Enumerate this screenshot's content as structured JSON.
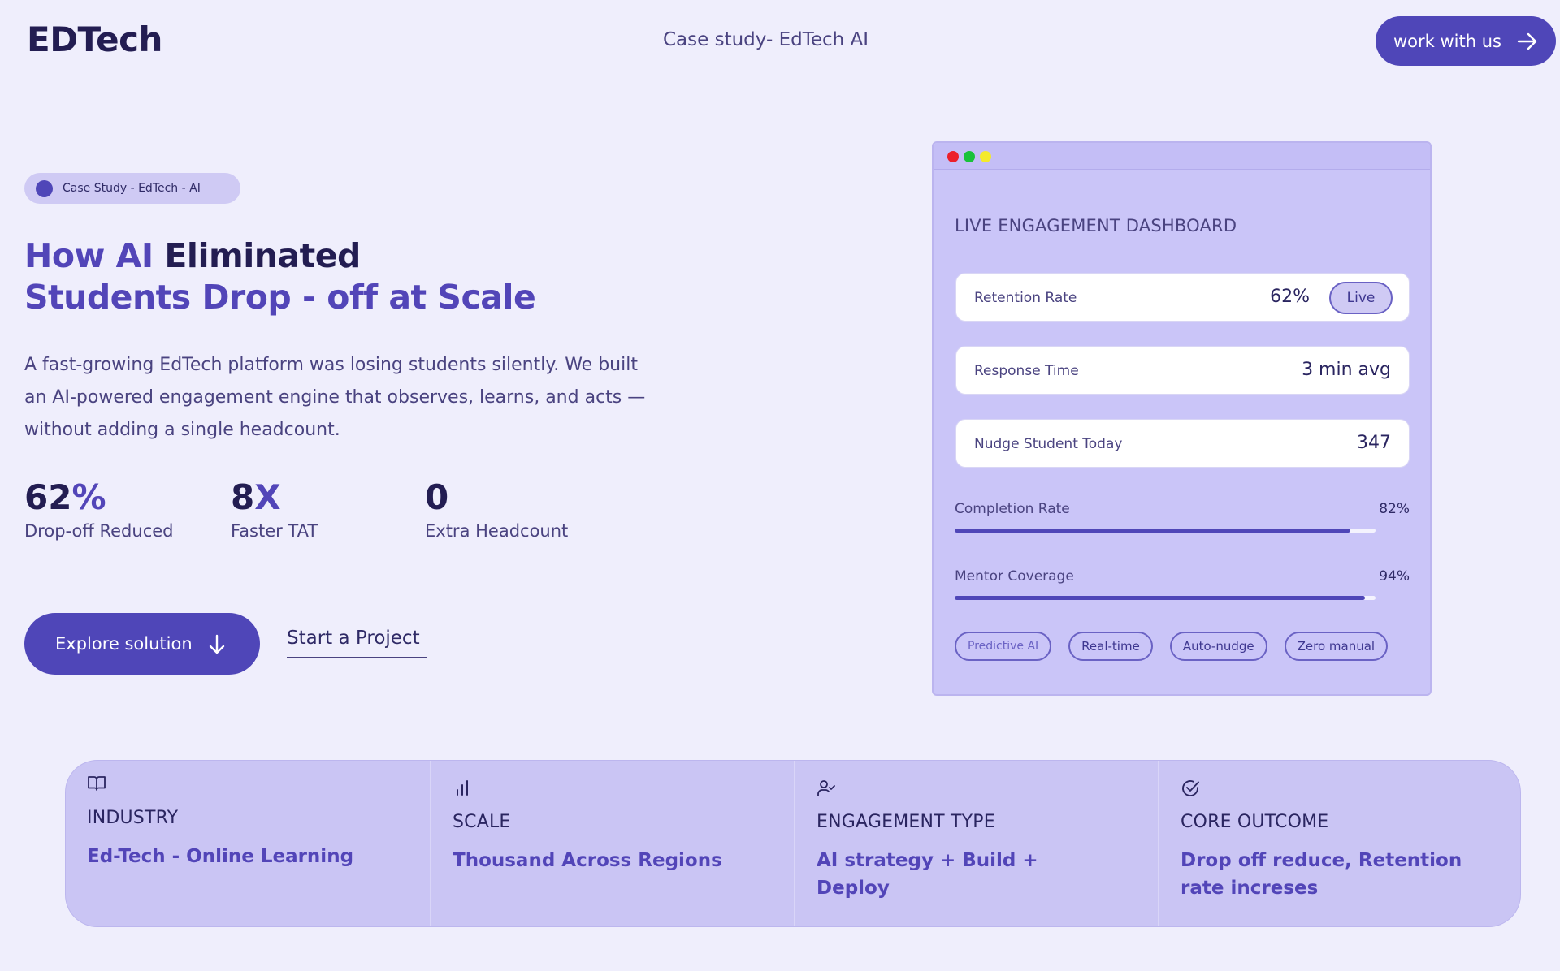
{
  "header": {
    "brand": "EDTech",
    "nav_title": "Case study- EdTech AI",
    "cta_label": "work with us"
  },
  "hero": {
    "pill_label": "Case Study - EdTech - AI",
    "headline": {
      "part1": "How AI ",
      "part2": "Eliminated",
      "part3": "Students Drop - off at Scale"
    },
    "lede": "A fast-growing EdTech platform was losing students silently. We built an AI-powered engagement engine that observes, learns, and acts — without adding a single headcount.",
    "stats": [
      {
        "num": "62",
        "suffix": "%",
        "label": "Drop-off Reduced"
      },
      {
        "num": "8",
        "suffix": "X",
        "label": "Faster TAT"
      },
      {
        "num": "0",
        "suffix": "",
        "label": "Extra Headcount"
      }
    ],
    "explore_label": "Explore solution",
    "start_label": "Start a Project"
  },
  "dashboard": {
    "title": "LIVE ENGAGEMENT DASHBOARD",
    "metrics": [
      {
        "label": "Retention Rate",
        "value": "62%",
        "badge": "Live"
      },
      {
        "label": "Response Time",
        "value": "3 min avg"
      },
      {
        "label": "Nudge Student Today",
        "value": "347"
      }
    ],
    "progress": [
      {
        "label": "Completion Rate",
        "value": "82%",
        "fraction": 0.94
      },
      {
        "label": "Mentor Coverage",
        "value": "94%",
        "fraction": 0.975
      }
    ],
    "tags": [
      "Predictive AI",
      "Real-time",
      "Auto-nudge",
      "Zero manual"
    ]
  },
  "facts": [
    {
      "icon": "book-icon",
      "heading": "INDUSTRY",
      "value": "Ed-Tech - Online Learning"
    },
    {
      "icon": "bar-chart-icon",
      "heading": "SCALE",
      "value": "Thousand Across Regions"
    },
    {
      "icon": "user-check-icon",
      "heading": "ENGAGEMENT TYPE",
      "value": "AI strategy + Build + Deploy"
    },
    {
      "icon": "check-circle-icon",
      "heading": "CORE OUTCOME",
      "value": "Drop off reduce,  Retention rate increses"
    }
  ],
  "colors": {
    "background": "#efeefc",
    "accent": "#4f46b8",
    "accent_text": "#5245b8",
    "dark_text": "#231d52",
    "card": "#cac5f8"
  }
}
